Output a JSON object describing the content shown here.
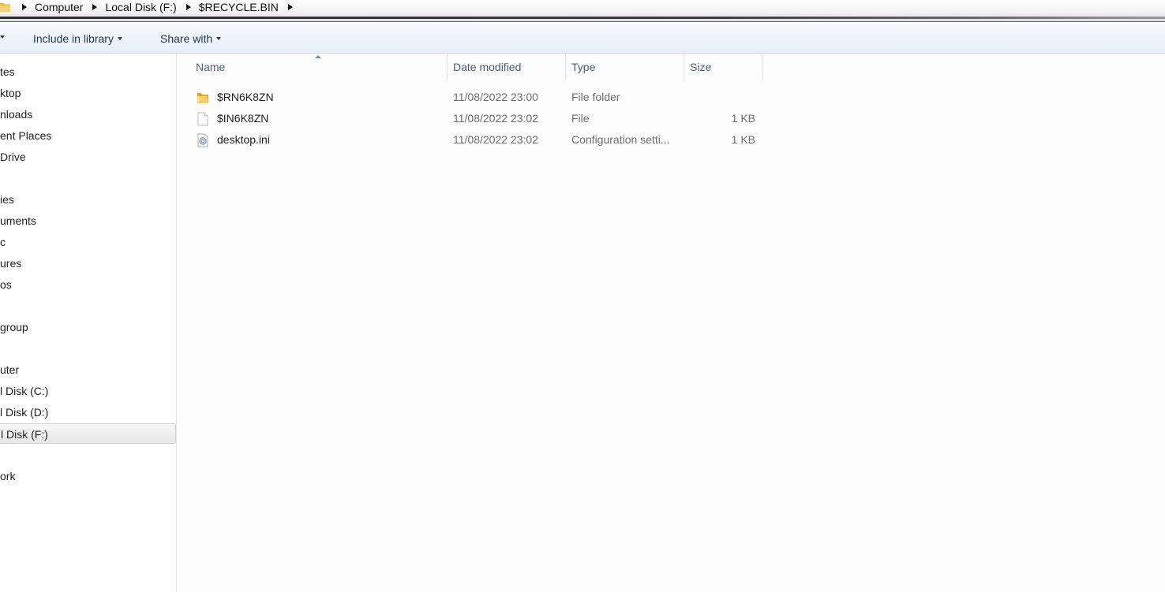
{
  "breadcrumb": {
    "items": [
      "Computer",
      "Local Disk (F:)",
      "$RECYCLE.BIN"
    ]
  },
  "toolbar": {
    "include_label": "Include in library",
    "share_label": "Share with"
  },
  "nav": {
    "items": [
      {
        "label": "tes"
      },
      {
        "label": "ktop"
      },
      {
        "label": "nloads"
      },
      {
        "label": "ent Places"
      },
      {
        "label": "Drive"
      },
      {
        "label": "ies"
      },
      {
        "label": "uments"
      },
      {
        "label": "c"
      },
      {
        "label": "ures"
      },
      {
        "label": "os"
      },
      {
        "label": "group"
      },
      {
        "label": "uter"
      },
      {
        "label": "l Disk (C:)"
      },
      {
        "label": "l Disk (D:)"
      },
      {
        "label": "l Disk (F:)"
      },
      {
        "label": "ork"
      }
    ],
    "selected_index": 14
  },
  "columns": {
    "name": "Name",
    "date": "Date modified",
    "type": "Type",
    "size": "Size"
  },
  "files": [
    {
      "icon": "folder-icon",
      "name": "$RN6K8ZN",
      "date": "11/08/2022 23:00",
      "type": "File folder",
      "size": ""
    },
    {
      "icon": "file-icon",
      "name": "$IN6K8ZN",
      "date": "11/08/2022 23:02",
      "type": "File",
      "size": "1 KB"
    },
    {
      "icon": "settings-file-icon",
      "name": "desktop.ini",
      "date": "11/08/2022 23:02",
      "type": "Configuration setti...",
      "size": "1 KB"
    }
  ],
  "colors": {
    "toolbar_text": "#1e3552",
    "header_text": "#4c607a",
    "detail_text": "#6d6d6d"
  }
}
